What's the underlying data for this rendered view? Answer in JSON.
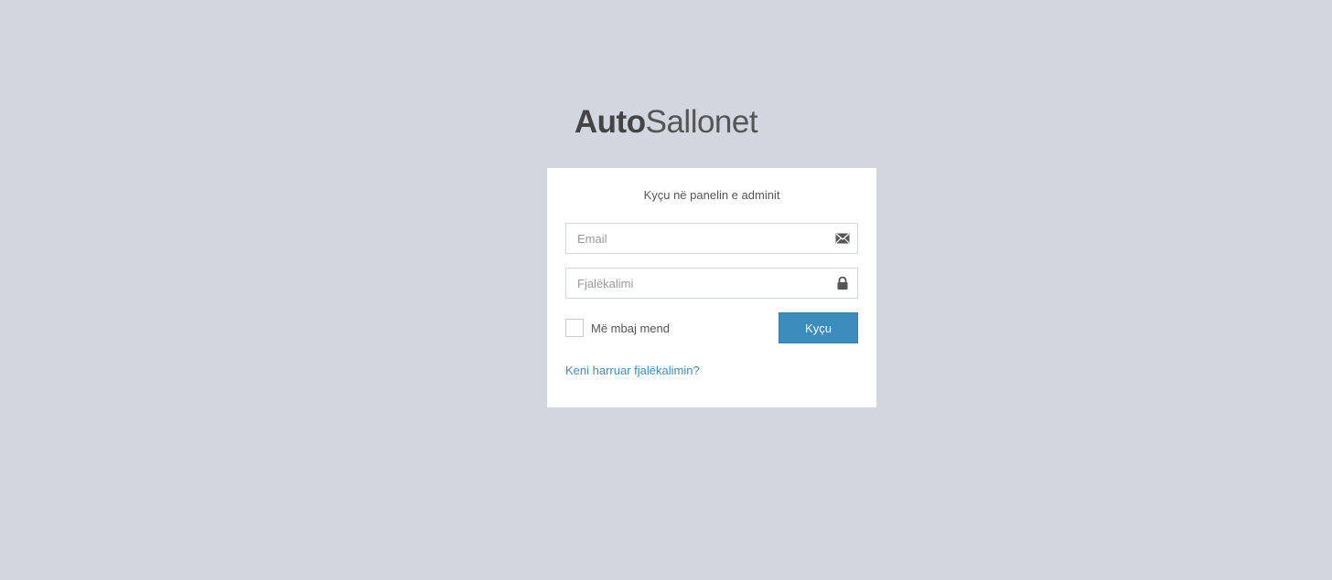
{
  "logo": {
    "bold": "Auto",
    "light": "Sallonet"
  },
  "login": {
    "message": "Kyçu në panelin e adminit",
    "email_placeholder": "Email",
    "email_icon": "envelope-icon",
    "password_placeholder": "Fjalëkalimi",
    "password_icon": "lock-icon",
    "remember_label": "Më mbaj mend",
    "remember_checked": false,
    "submit_label": "Kyçu",
    "forgot_link": "Keni harruar fjalëkalimin?"
  },
  "colors": {
    "background": "#d2d6de",
    "primary": "#3c8dbc",
    "link": "#3c8dbc"
  }
}
